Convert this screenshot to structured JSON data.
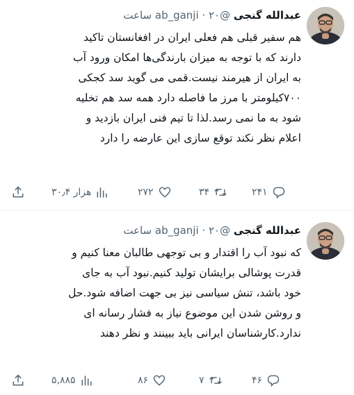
{
  "tweets": [
    {
      "author": "عبدالله گنجی",
      "handle": "@ab_ganji",
      "time": "۲۰ ساعت",
      "lines": [
        "هم سفیر قبلی هم فعلی ایران در افغانستان تاکید",
        "دارند که با توجه به میزان بارندگی‌ها امکان ورود آب",
        "به ایران از هیرمند نیست.قمی می گوید سد کجکی",
        "۷۰۰کیلومتر با مرز ما فاصله دارد همه سد هم تخلیه",
        "شود به ما نمی رسد.لذا تا تیم فنی ایران بازدید و",
        "اعلام نظر نکند توقع سازی این عارضه را دارد"
      ],
      "stats": {
        "replies": "۲۴۱",
        "retweets": "۳۴",
        "likes": "۲۷۲",
        "views": "۳۰٫۴ هزار"
      },
      "icons": {
        "reply": "reply-icon",
        "retweet": "retweet-icon",
        "like": "heart-icon",
        "views": "views-icon",
        "share": "share-icon"
      }
    },
    {
      "author": "عبدالله گنجی",
      "handle": "@ab_ganji",
      "time": "۲۰ ساعت",
      "lines": [
        "که نبود آب را اقتدار و بی توجهی طالبان معنا کنیم و",
        "قدرت پوشالی برایشان تولید کنیم.نبود آب به جای",
        "خود باشد، تنش سیاسی نیز بی جهت اضافه شود.حل",
        "و روشن شدن این موضوع نیاز به فشار رسانه ای",
        "ندارد.کارشناسان ایرانی باید ببینند و نظر دهند"
      ],
      "stats": {
        "replies": "۴۶",
        "retweets": "۷",
        "likes": "۸۶",
        "views": "۵,۸۸۵"
      },
      "icons": {
        "reply": "reply-icon",
        "retweet": "retweet-icon",
        "like": "heart-icon",
        "views": "views-icon",
        "share": "share-icon"
      }
    }
  ],
  "colors": {
    "text": "#0f1419",
    "secondary": "#536471",
    "divider": "#eff3f4"
  }
}
